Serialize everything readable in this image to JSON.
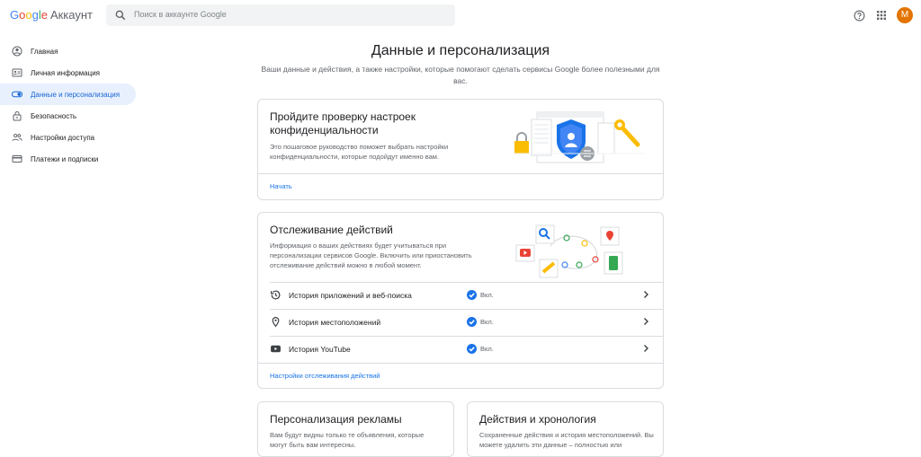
{
  "header": {
    "logo_letters": [
      "G",
      "o",
      "o",
      "g",
      "l",
      "e"
    ],
    "product": "Аккаунт",
    "search_placeholder": "Поиск в аккаунте Google",
    "avatar_letter": "М",
    "help_icon": "help-icon",
    "apps_icon": "apps-grid-icon"
  },
  "sidebar": {
    "items": [
      {
        "label": "Главная",
        "icon": "home-icon",
        "active": false
      },
      {
        "label": "Личная информация",
        "icon": "id-card-icon",
        "active": false
      },
      {
        "label": "Данные и персонализация",
        "icon": "toggle-icon",
        "active": true
      },
      {
        "label": "Безопасность",
        "icon": "lock-icon",
        "active": false
      },
      {
        "label": "Настройки доступа",
        "icon": "people-icon",
        "active": false
      },
      {
        "label": "Платежи и подписки",
        "icon": "credit-card-icon",
        "active": false
      }
    ]
  },
  "main": {
    "title": "Данные и персонализация",
    "subtitle": "Ваши данные и действия, а также настройки, которые помогают сделать сервисы Google более полезными для вас."
  },
  "privacy_card": {
    "title": "Пройдите проверку настроек конфиденциальности",
    "description": "Это пошаговое руководство поможет выбрать настройки конфиденциальности, которые подойдут именно вам.",
    "link": "Начать"
  },
  "activity_card": {
    "title": "Отслеживание действий",
    "description": "Информация о ваших действиях будет учитываться при персонализации сервисов Google. Включить или приостановить отслеживание действий можно в любой момент.",
    "rows": [
      {
        "label": "История приложений и веб-поиска",
        "status": "Вкл.",
        "icon": "history-icon"
      },
      {
        "label": "История местоположений",
        "status": "Вкл.",
        "icon": "location-pin-icon"
      },
      {
        "label": "История YouTube",
        "status": "Вкл.",
        "icon": "youtube-icon"
      }
    ],
    "link": "Настройки отслеживания действий"
  },
  "ads_card": {
    "title": "Персонализация рекламы",
    "description": "Вам будут видны только те объявления, которые могут быть вам интересны."
  },
  "timeline_card": {
    "title": "Действия и хронология",
    "description": "Сохраненные действия и история местоположений. Вы можете удалить эти данные – полностью или"
  },
  "colors": {
    "accent_blue": "#1a73e8",
    "active_nav_bg": "#e8f0fe",
    "border": "#dadce0",
    "avatar_bg": "#e37400"
  }
}
